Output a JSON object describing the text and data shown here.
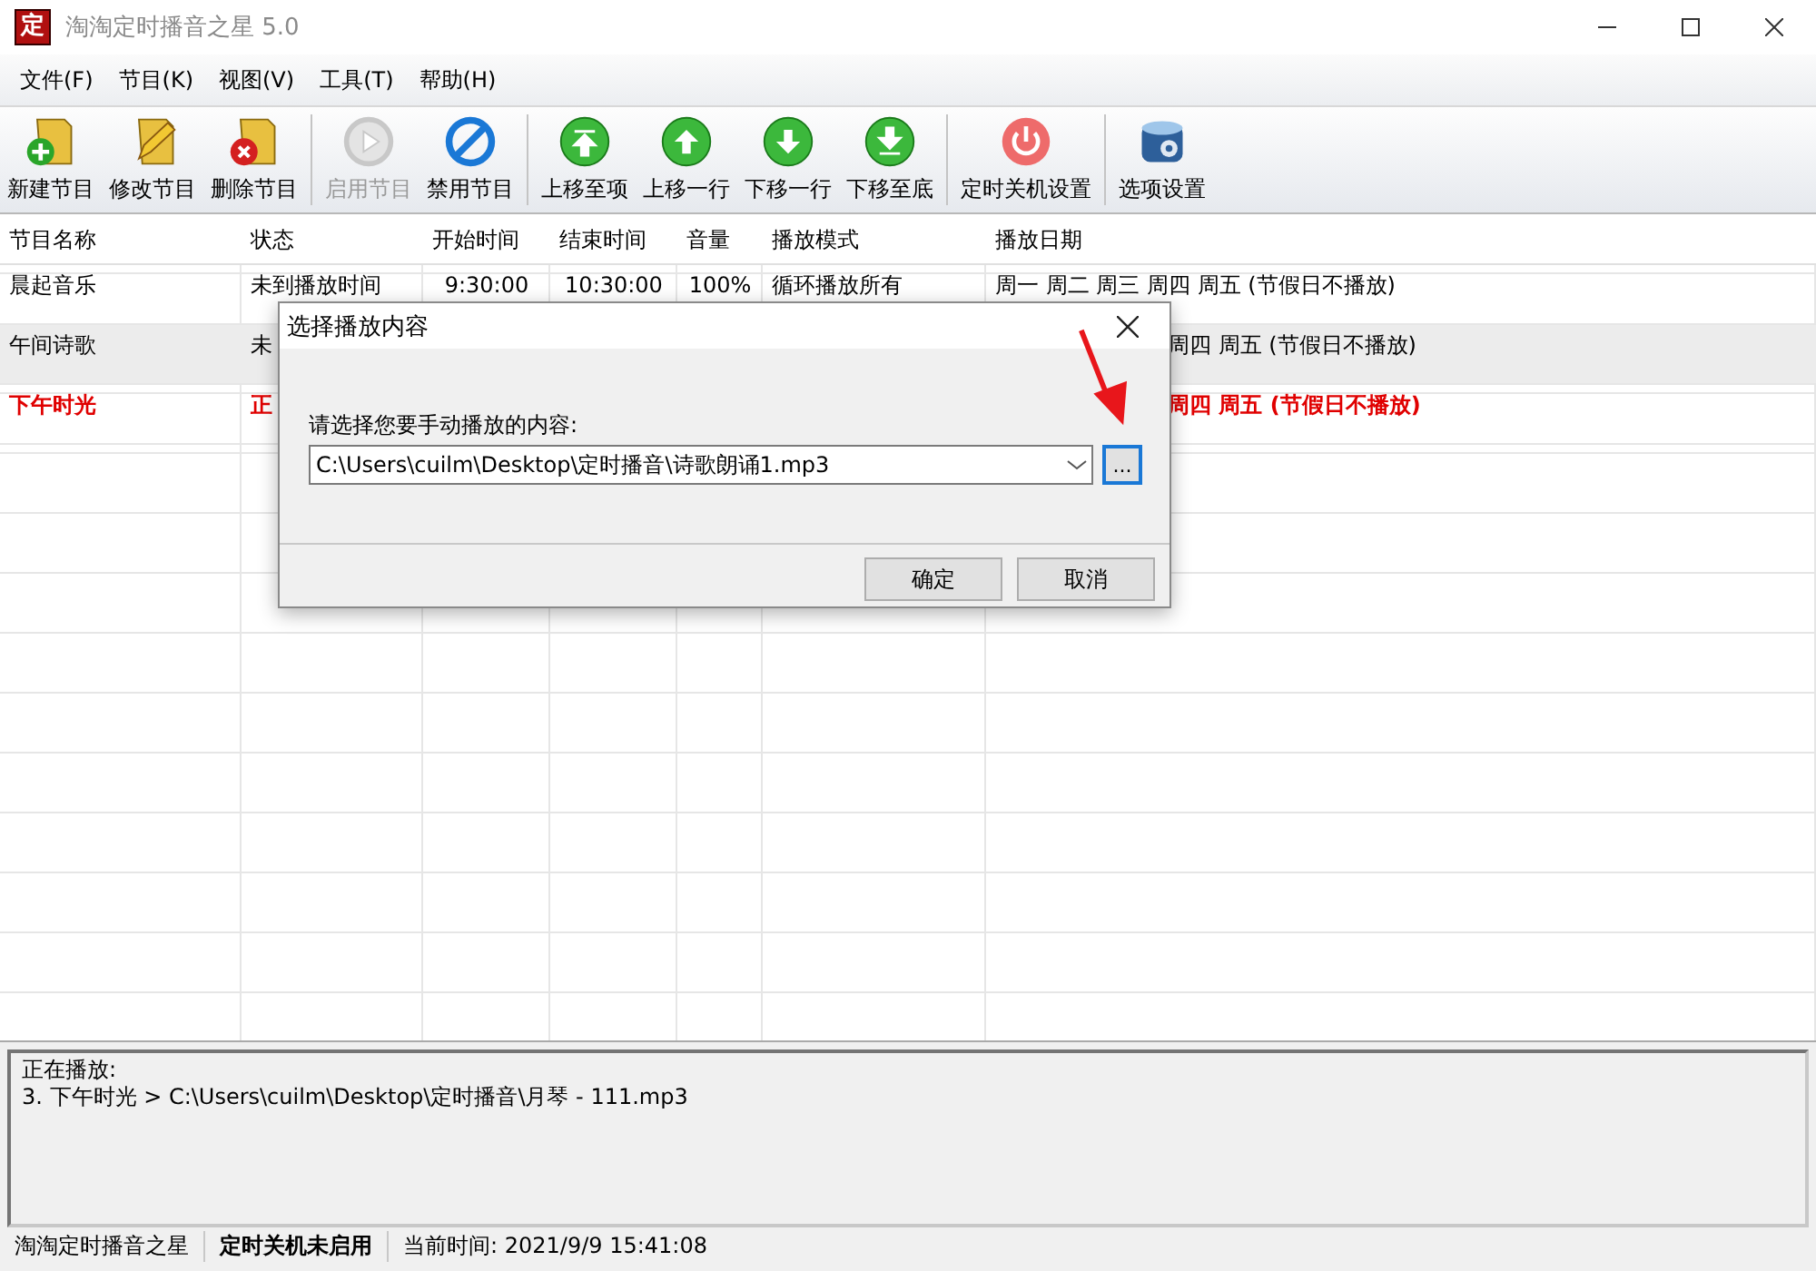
{
  "window": {
    "icon_text": "定",
    "title": "淘淘定时播音之星 5.0"
  },
  "menu": [
    "文件(F)",
    "节目(K)",
    "视图(V)",
    "工具(T)",
    "帮助(H)"
  ],
  "toolbar": [
    {
      "kind": "new",
      "label": "新建节目",
      "disabled": false
    },
    {
      "kind": "edit",
      "label": "修改节目",
      "disabled": false
    },
    {
      "kind": "delete",
      "label": "删除节目",
      "disabled": false
    },
    {
      "kind": "separator"
    },
    {
      "kind": "enable",
      "label": "启用节目",
      "disabled": true
    },
    {
      "kind": "disable",
      "label": "禁用节目",
      "disabled": false
    },
    {
      "kind": "separator"
    },
    {
      "kind": "top",
      "label": "上移至项",
      "disabled": false
    },
    {
      "kind": "up",
      "label": "上移一行",
      "disabled": false
    },
    {
      "kind": "down",
      "label": "下移一行",
      "disabled": false
    },
    {
      "kind": "bottom",
      "label": "下移至底",
      "disabled": false
    },
    {
      "kind": "separator"
    },
    {
      "kind": "power",
      "label": "定时关机设置",
      "disabled": false
    },
    {
      "kind": "separator"
    },
    {
      "kind": "options",
      "label": "选项设置",
      "disabled": false
    }
  ],
  "table": {
    "columns": [
      "节目名称",
      "状态",
      "开始时间",
      "结束时间",
      "音量",
      "播放模式",
      "播放日期"
    ],
    "rows": [
      {
        "selected": false,
        "playing": false,
        "cells": [
          "晨起音乐",
          "未到播放时间",
          "9:30:00",
          "10:30:00",
          "100%",
          "循环播放所有",
          "周一 周二 周三 周四 周五 (节假日不播放)"
        ]
      },
      {
        "selected": true,
        "playing": false,
        "cells": [
          "午间诗歌",
          "未",
          null,
          null,
          null,
          null,
          "周四 周五 (节假日不播放)"
        ]
      },
      {
        "selected": false,
        "playing": true,
        "cells": [
          "下午时光",
          "正",
          null,
          null,
          null,
          null,
          "周四 周五 (节假日不播放)"
        ]
      }
    ]
  },
  "dialog": {
    "title": "选择播放内容",
    "label": "请选择您要手动播放的内容:",
    "value": "C:\\Users\\cuilm\\Desktop\\定时播音\\诗歌朗诵1.mp3",
    "browse": "...",
    "ok": "确定",
    "cancel": "取消"
  },
  "now_playing": {
    "heading": "正在播放:",
    "line": "3. 下午时光 > C:\\Users\\cuilm\\Desktop\\定时播音\\月琴 - 111.mp3"
  },
  "status_bar": [
    {
      "text": "淘淘定时播音之星",
      "bold": false
    },
    {
      "text": "定时关机未启用",
      "bold": true
    },
    {
      "text": "当前时间:  2021/9/9 15:41:08",
      "bold": false
    }
  ]
}
